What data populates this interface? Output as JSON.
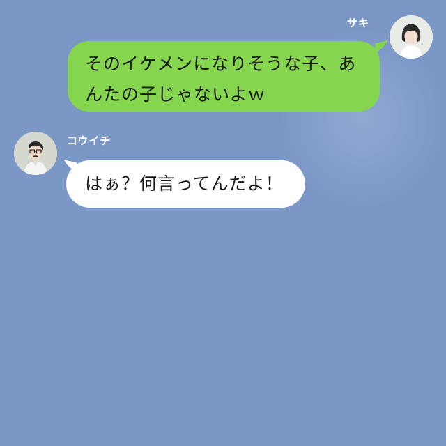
{
  "messages": [
    {
      "side": "right",
      "sender": "サキ",
      "avatar_icon": "woman-avatar-icon",
      "bubble_color": "#86d54e",
      "lines": [
        "そのイケメンになりそうな子、あ",
        "んたの子じゃないよｗ"
      ]
    },
    {
      "side": "left",
      "sender": "コウイチ",
      "avatar_icon": "man-with-glasses-avatar-icon",
      "bubble_color": "#ffffff",
      "lines": [
        "はぁ？何言ってんだよ！"
      ]
    }
  ],
  "colors": {
    "background": "#7b97c6",
    "name_text": "#ffffff"
  }
}
